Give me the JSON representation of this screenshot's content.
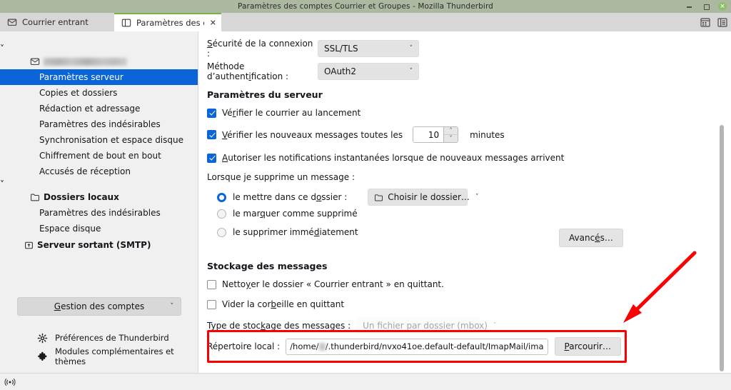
{
  "window": {
    "title": "Paramètres des comptes Courrier et Groupes - Mozilla Thunderbird",
    "controls": {
      "minimize": "minimize-icon",
      "maximize": "maximize-icon",
      "close": "close-icon",
      "close_glyph": "×"
    }
  },
  "tabs": [
    {
      "label": "Courrier entrant",
      "icon": "inbox-icon",
      "active": false
    },
    {
      "label": "Paramètres des comptes",
      "icon": "settings-panel-icon",
      "active": true,
      "close_glyph": "✕"
    }
  ],
  "tabbar_right": {
    "calendar_icon": "calendar-icon",
    "tasks_icon": "tasks-icon"
  },
  "sidebar": {
    "account": {
      "label": "",
      "redacted": true,
      "chevron": "˅",
      "icon": "envelope-icon"
    },
    "account_items": [
      {
        "label": "Paramètres serveur",
        "selected": true
      },
      {
        "label": "Copies et dossiers",
        "selected": false
      },
      {
        "label": "Rédaction et adressage",
        "selected": false
      },
      {
        "label": "Paramètres des indésirables",
        "selected": false
      },
      {
        "label": "Synchronisation et espace disque",
        "selected": false
      },
      {
        "label": "Chiffrement de bout en bout",
        "selected": false
      },
      {
        "label": "Accusés de réception",
        "selected": false
      }
    ],
    "local_folders": {
      "label": "Dossiers locaux",
      "chevron": "˅",
      "icon": "folder-icon"
    },
    "local_items": [
      {
        "label": "Paramètres des indésirables"
      },
      {
        "label": "Espace disque"
      }
    ],
    "smtp": {
      "label": "Serveur sortant (SMTP)",
      "icon": "outgoing-server-icon"
    },
    "manage_accounts": {
      "label": "Gestion des comptes",
      "chevron": "˅"
    },
    "links": [
      {
        "label": "Préférences de Thunderbird",
        "icon": "gear-icon"
      },
      {
        "label": "Modules complémentaires et thèmes",
        "icon": "puzzle-icon"
      }
    ]
  },
  "main": {
    "connection_security": {
      "label": "Sécurité de la connexion :",
      "value": "SSL/TLS",
      "chevron": "˅"
    },
    "auth_method": {
      "label": "Méthode d’authentification :",
      "value": "OAuth2",
      "chevron": "˅"
    },
    "server_settings": {
      "title": "Paramètres du serveur",
      "check_at_startup": {
        "label": "Vérifier le courrier au lancement",
        "checked": true
      },
      "check_interval": {
        "label_before": "Vérifier les nouveaux messages toutes les",
        "value": "10",
        "label_after": "minutes",
        "checked": true,
        "up_glyph": "˄",
        "down_glyph": "˅"
      },
      "allow_notifications": {
        "label": "Autoriser les notifications instantanées lorsque de nouveaux messages arrivent",
        "checked": true
      },
      "delete_prompt": "Lorsque je supprime un message :",
      "delete_options": [
        {
          "label": "le mettre dans ce dossier :",
          "selected": true
        },
        {
          "label": "le marquer comme supprimé",
          "selected": false
        },
        {
          "label": "le supprimer immédiatement",
          "selected": false
        }
      ],
      "folder_picker": {
        "value": "Choisir le dossier…",
        "icon": "folder-icon",
        "chevron": "˅"
      },
      "advanced_button": "Avancés…"
    },
    "message_storage": {
      "title": "Stockage des messages",
      "clean_inbox": {
        "label": "Nettoyer le dossier « Courrier entrant » en quittant.",
        "checked": false
      },
      "empty_trash": {
        "label": "Vider la corbeille en quittant",
        "checked": false
      },
      "storage_type": {
        "label": "Type de stockage des messages :",
        "value": "Un fichier par dossier (mbox)",
        "disabled": true,
        "chevron": "˅"
      },
      "local_directory": {
        "label": "Répertoire local :",
        "path_prefix": "/home/",
        "path_suffix": "/.thunderbird/nvxo41oe.default-default/ImapMail/ima",
        "redacted_user": true,
        "browse_button": "Parcourir…"
      }
    }
  },
  "annotations": {
    "highlight_color": "#fb0000",
    "arrow": "red-arrow-pointing-to-local-directory"
  },
  "statusbar": {
    "icon": "connectivity-icon"
  }
}
